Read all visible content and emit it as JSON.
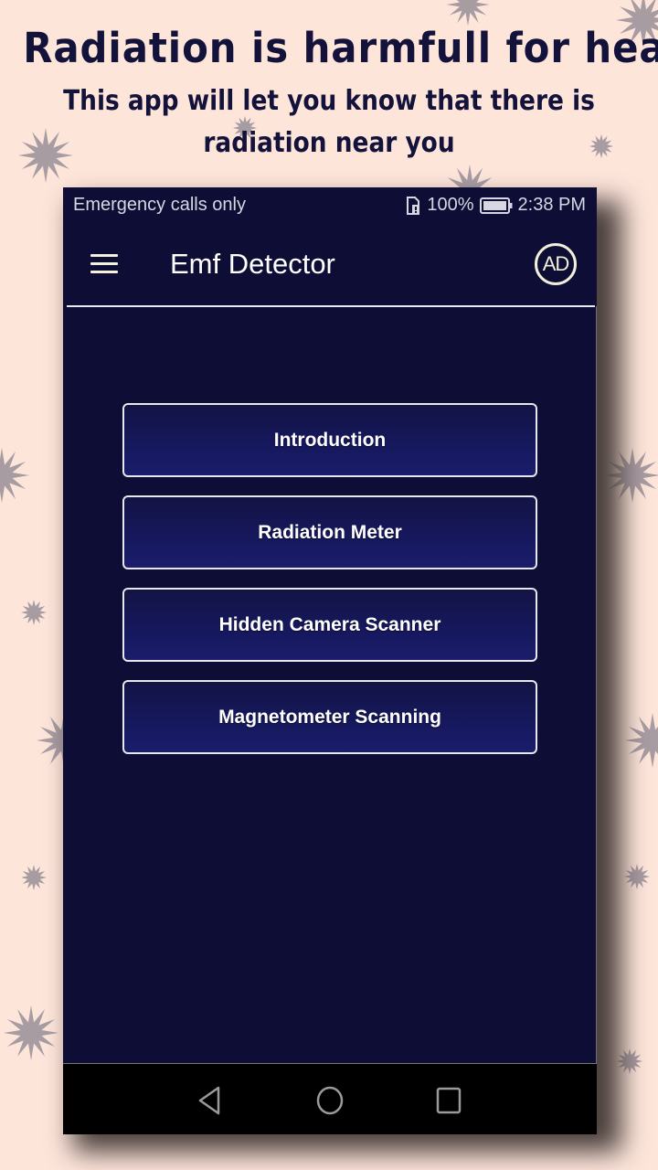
{
  "promo": {
    "headline": "Radiation is harmfull for health",
    "subline_1": "This app will let you know that there is",
    "subline_2": "radiation near you"
  },
  "status_bar": {
    "carrier_text": "Emergency calls only",
    "sim_icon": "sim-alert-icon",
    "battery_percent": "100%",
    "battery_icon": "battery-full-icon",
    "time": "2:38 PM"
  },
  "app_bar": {
    "menu_icon": "hamburger-menu-icon",
    "title": "Emf Detector",
    "ad_label": "AD"
  },
  "menu": {
    "items": [
      {
        "label": "Introduction"
      },
      {
        "label": "Radiation Meter"
      },
      {
        "label": "Hidden Camera Scanner"
      },
      {
        "label": "Magnetometer Scanning"
      }
    ]
  },
  "nav_bar": {
    "back_icon": "back-triangle-icon",
    "home_icon": "home-circle-icon",
    "recents_icon": "recents-square-icon"
  },
  "colors": {
    "background": "#fde5da",
    "headline": "#12123a",
    "app_background": "#0e0d36",
    "button_fill": "#16185e",
    "button_border": "#e7e7ee",
    "decor_star": "#a89ca3"
  }
}
